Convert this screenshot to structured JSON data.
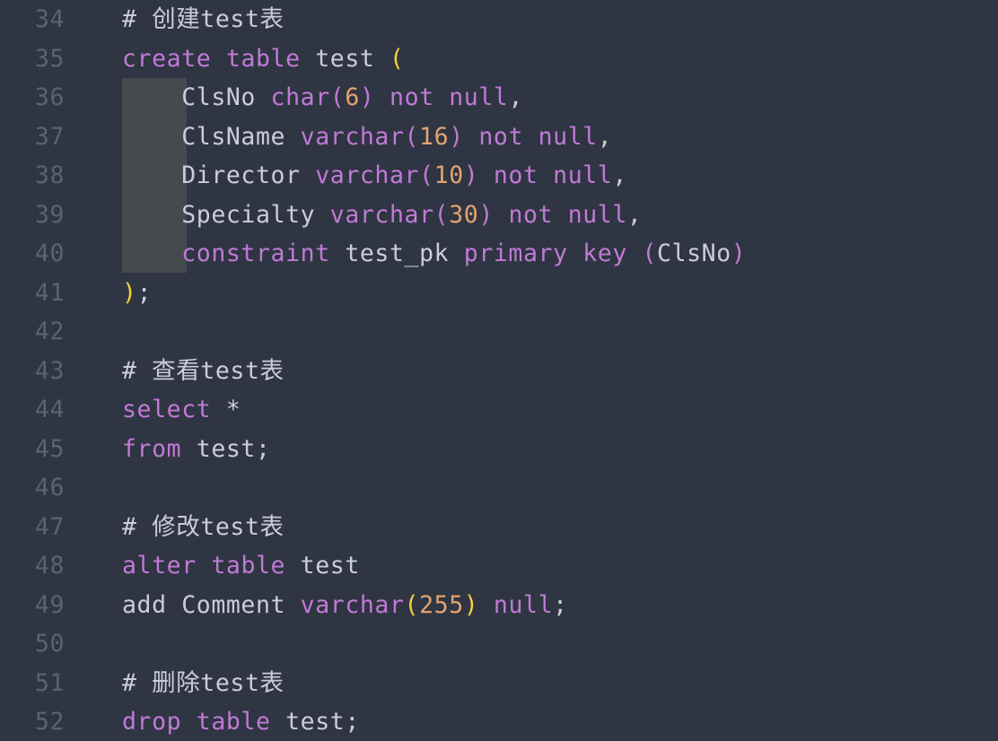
{
  "colors": {
    "background": "#2f3542",
    "gutter": "#5b6272",
    "plain": "#c9ced8",
    "keyword": "#c07ad6",
    "number": "#e3a46d",
    "bracket": "#f5d23a",
    "indent_guide": "#444a4d"
  },
  "lines": [
    {
      "num": "34",
      "tokens": [
        {
          "t": "# 创建test表",
          "c": "comment"
        }
      ]
    },
    {
      "num": "35",
      "tokens": [
        {
          "t": "create",
          "c": "kw"
        },
        {
          "t": " ",
          "c": "plain"
        },
        {
          "t": "table",
          "c": "kw"
        },
        {
          "t": " test ",
          "c": "plain"
        },
        {
          "t": "(",
          "c": "brk"
        }
      ]
    },
    {
      "num": "36",
      "tokens": [
        {
          "t": "    ClsNo ",
          "c": "plain"
        },
        {
          "t": "char",
          "c": "kw"
        },
        {
          "t": "(",
          "c": "par"
        },
        {
          "t": "6",
          "c": "num"
        },
        {
          "t": ")",
          "c": "par"
        },
        {
          "t": " ",
          "c": "plain"
        },
        {
          "t": "not",
          "c": "kw"
        },
        {
          "t": " ",
          "c": "plain"
        },
        {
          "t": "null",
          "c": "kw"
        },
        {
          "t": ",",
          "c": "plain"
        }
      ]
    },
    {
      "num": "37",
      "tokens": [
        {
          "t": "    ClsName ",
          "c": "plain"
        },
        {
          "t": "varchar",
          "c": "kw"
        },
        {
          "t": "(",
          "c": "par"
        },
        {
          "t": "16",
          "c": "num"
        },
        {
          "t": ")",
          "c": "par"
        },
        {
          "t": " ",
          "c": "plain"
        },
        {
          "t": "not",
          "c": "kw"
        },
        {
          "t": " ",
          "c": "plain"
        },
        {
          "t": "null",
          "c": "kw"
        },
        {
          "t": ",",
          "c": "plain"
        }
      ]
    },
    {
      "num": "38",
      "tokens": [
        {
          "t": "    Director ",
          "c": "plain"
        },
        {
          "t": "varchar",
          "c": "kw"
        },
        {
          "t": "(",
          "c": "par"
        },
        {
          "t": "10",
          "c": "num"
        },
        {
          "t": ")",
          "c": "par"
        },
        {
          "t": " ",
          "c": "plain"
        },
        {
          "t": "not",
          "c": "kw"
        },
        {
          "t": " ",
          "c": "plain"
        },
        {
          "t": "null",
          "c": "kw"
        },
        {
          "t": ",",
          "c": "plain"
        }
      ]
    },
    {
      "num": "39",
      "tokens": [
        {
          "t": "    Specialty ",
          "c": "plain"
        },
        {
          "t": "varchar",
          "c": "kw"
        },
        {
          "t": "(",
          "c": "par"
        },
        {
          "t": "30",
          "c": "num"
        },
        {
          "t": ")",
          "c": "par"
        },
        {
          "t": " ",
          "c": "plain"
        },
        {
          "t": "not",
          "c": "kw"
        },
        {
          "t": " ",
          "c": "plain"
        },
        {
          "t": "null",
          "c": "kw"
        },
        {
          "t": ",",
          "c": "plain"
        }
      ]
    },
    {
      "num": "40",
      "tokens": [
        {
          "t": "    ",
          "c": "plain"
        },
        {
          "t": "constraint",
          "c": "kw"
        },
        {
          "t": " test_pk ",
          "c": "plain"
        },
        {
          "t": "primary",
          "c": "kw"
        },
        {
          "t": " ",
          "c": "plain"
        },
        {
          "t": "key",
          "c": "kw"
        },
        {
          "t": " ",
          "c": "plain"
        },
        {
          "t": "(",
          "c": "par"
        },
        {
          "t": "ClsNo",
          "c": "plain"
        },
        {
          "t": ")",
          "c": "par"
        }
      ]
    },
    {
      "num": "41",
      "tokens": [
        {
          "t": ")",
          "c": "brk"
        },
        {
          "t": ";",
          "c": "plain"
        }
      ]
    },
    {
      "num": "42",
      "tokens": []
    },
    {
      "num": "43",
      "tokens": [
        {
          "t": "# 查看test表",
          "c": "comment"
        }
      ]
    },
    {
      "num": "44",
      "tokens": [
        {
          "t": "select",
          "c": "kw"
        },
        {
          "t": " *",
          "c": "plain"
        }
      ]
    },
    {
      "num": "45",
      "tokens": [
        {
          "t": "from",
          "c": "kw"
        },
        {
          "t": " test;",
          "c": "plain"
        }
      ]
    },
    {
      "num": "46",
      "tokens": []
    },
    {
      "num": "47",
      "tokens": [
        {
          "t": "# 修改test表",
          "c": "comment"
        }
      ]
    },
    {
      "num": "48",
      "tokens": [
        {
          "t": "alter",
          "c": "kw"
        },
        {
          "t": " ",
          "c": "plain"
        },
        {
          "t": "table",
          "c": "kw"
        },
        {
          "t": " test",
          "c": "plain"
        }
      ]
    },
    {
      "num": "49",
      "tokens": [
        {
          "t": "add Comment ",
          "c": "plain"
        },
        {
          "t": "varchar",
          "c": "kw"
        },
        {
          "t": "(",
          "c": "brk"
        },
        {
          "t": "255",
          "c": "num"
        },
        {
          "t": ")",
          "c": "brk"
        },
        {
          "t": " ",
          "c": "plain"
        },
        {
          "t": "null",
          "c": "kw"
        },
        {
          "t": ";",
          "c": "plain"
        }
      ]
    },
    {
      "num": "50",
      "tokens": []
    },
    {
      "num": "51",
      "tokens": [
        {
          "t": "# 删除test表",
          "c": "comment"
        }
      ]
    },
    {
      "num": "52",
      "tokens": [
        {
          "t": "drop",
          "c": "kw"
        },
        {
          "t": " ",
          "c": "plain"
        },
        {
          "t": "table",
          "c": "kw"
        },
        {
          "t": " test;",
          "c": "plain"
        }
      ]
    }
  ]
}
